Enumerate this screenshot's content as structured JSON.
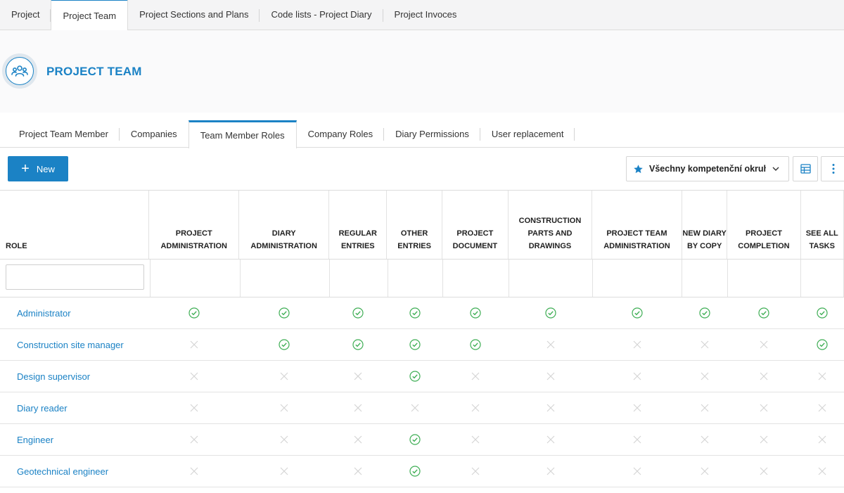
{
  "top_tabs": [
    {
      "label": "Project"
    },
    {
      "label": "Project Team"
    },
    {
      "label": "Project Sections and Plans"
    },
    {
      "label": "Code lists - Project Diary"
    },
    {
      "label": "Project Invoces"
    }
  ],
  "header": {
    "title": "PROJECT TEAM",
    "icon": "people-icon"
  },
  "sub_tabs": [
    {
      "label": "Project Team Member"
    },
    {
      "label": "Companies"
    },
    {
      "label": "Team Member Roles"
    },
    {
      "label": "Company Roles"
    },
    {
      "label": "Diary Permissions"
    },
    {
      "label": "User replacement"
    }
  ],
  "toolbar": {
    "new_label": "New",
    "filter_value": "Všechny kompetenční okruhy",
    "filter_icon": "star-icon",
    "columns_icon": "table-icon",
    "more_icon": "more-vertical-icon"
  },
  "table": {
    "columns": [
      "ROLE",
      "PROJECT ADMINISTRATION",
      "DIARY ADMINISTRATION",
      "REGULAR ENTRIES",
      "OTHER ENTRIES",
      "PROJECT DOCUMENT",
      "CONSTRUCTION PARTS AND DRAWINGS",
      "PROJECT TEAM ADMINISTRATION",
      "NEW DIARY BY COPY",
      "PROJECT COMPLETION",
      "SEE ALL TASKS"
    ],
    "rows": [
      {
        "role": "Administrator",
        "perms": [
          true,
          true,
          true,
          true,
          true,
          true,
          true,
          true,
          true,
          true
        ]
      },
      {
        "role": "Construction site manager",
        "perms": [
          false,
          true,
          true,
          true,
          true,
          false,
          false,
          false,
          false,
          true
        ]
      },
      {
        "role": "Design supervisor",
        "perms": [
          false,
          false,
          false,
          true,
          false,
          false,
          false,
          false,
          false,
          false
        ]
      },
      {
        "role": "Diary reader",
        "perms": [
          false,
          false,
          false,
          false,
          false,
          false,
          false,
          false,
          false,
          false
        ]
      },
      {
        "role": "Engineer",
        "perms": [
          false,
          false,
          false,
          true,
          false,
          false,
          false,
          false,
          false,
          false
        ]
      },
      {
        "role": "Geotechnical engineer",
        "perms": [
          false,
          false,
          false,
          true,
          false,
          false,
          false,
          false,
          false,
          false
        ]
      }
    ]
  },
  "colors": {
    "accent": "#1b82c5",
    "check": "#3fae55",
    "cross": "#d5d5d5"
  }
}
